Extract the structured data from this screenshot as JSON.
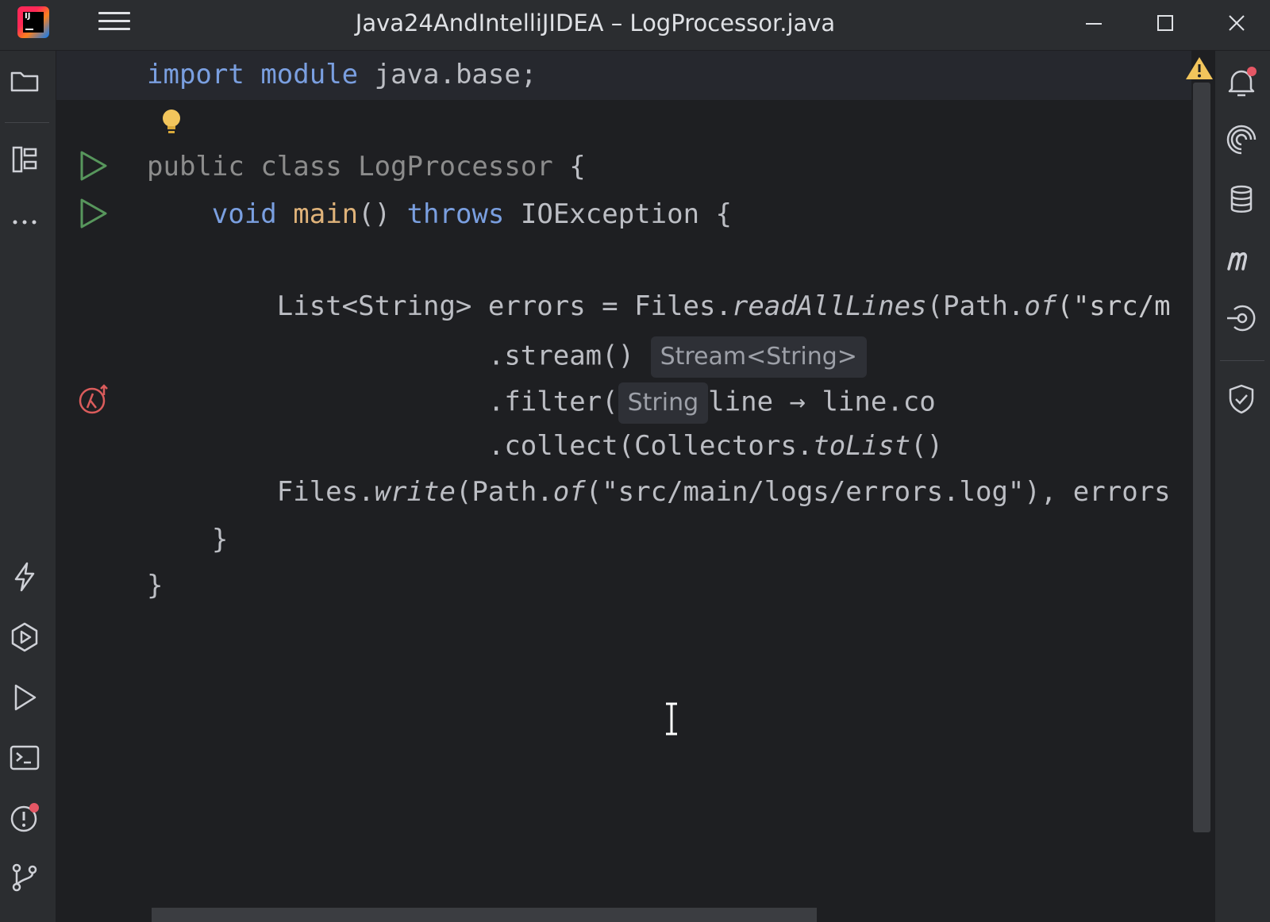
{
  "window": {
    "title": "Java24AndIntelliJIDEA – LogProcessor.java",
    "logo_text": "IJ",
    "logo_sub": "EAP"
  },
  "left_toolbar": {
    "items": [
      "project-icon",
      "structure-icon",
      "more-icon",
      "flash-icon",
      "services-icon",
      "run-icon",
      "terminal-icon",
      "problems-icon",
      "git-icon"
    ]
  },
  "right_toolbar": {
    "items": [
      "notifications-icon",
      "ai-assistant-icon",
      "database-icon",
      "maven-icon",
      "endpoints-icon",
      "security-icon"
    ]
  },
  "editor": {
    "lines": [
      {
        "id": "import",
        "tokens": [
          [
            "import",
            "kw"
          ],
          [
            " ",
            ""
          ],
          [
            "module",
            "kw"
          ],
          [
            " java.base;",
            ""
          ]
        ]
      },
      {
        "id": "class",
        "tokens": [
          [
            "public",
            "kw-dim"
          ],
          [
            " ",
            ""
          ],
          [
            "class",
            "kw-dim"
          ],
          [
            " LogProcessor",
            ""
          ],
          [
            " {",
            ""
          ]
        ]
      },
      {
        "id": "main",
        "tokens": [
          [
            "    ",
            ""
          ],
          [
            "void",
            "kw"
          ],
          [
            " ",
            ""
          ],
          [
            "main",
            "fn"
          ],
          [
            "() ",
            ""
          ],
          [
            "throws",
            "kw"
          ],
          [
            " IOException {",
            ""
          ]
        ]
      },
      {
        "id": "errors",
        "tokens": [
          [
            "        List<String> errors = Files.",
            ""
          ],
          [
            "readAllLines",
            "it"
          ],
          [
            "(Path.",
            ""
          ],
          [
            "of",
            "it"
          ],
          [
            "(\"src/m",
            ""
          ]
        ]
      },
      {
        "id": "stream",
        "tokens": [
          [
            "                     .stream()",
            ""
          ]
        ],
        "hint": "Stream<String>"
      },
      {
        "id": "filter",
        "tokens": [
          [
            "                     .filter(",
            ""
          ]
        ],
        "hint": "String",
        "after": "line → line.co"
      },
      {
        "id": "collect",
        "tokens": [
          [
            "                     .collect(Collectors.",
            ""
          ],
          [
            "toList",
            "it"
          ],
          [
            "()",
            ""
          ]
        ]
      },
      {
        "id": "write",
        "tokens": [
          [
            "        Files.",
            ""
          ],
          [
            "write",
            "it"
          ],
          [
            "(Path.",
            ""
          ],
          [
            "of",
            "it"
          ],
          [
            "(\"src/main/logs/errors.log\"), errors",
            ""
          ]
        ]
      },
      {
        "id": "close-main",
        "tokens": [
          [
            "    }",
            ""
          ]
        ]
      },
      {
        "id": "close-class",
        "tokens": [
          [
            "}",
            ""
          ]
        ]
      }
    ]
  },
  "colors": {
    "background": "#1e1f22",
    "panel": "#2b2d30",
    "keyword": "#7a9fe0",
    "method": "#e0b37a",
    "run_gutter": "#57965c",
    "warning": "#f2c55c"
  }
}
